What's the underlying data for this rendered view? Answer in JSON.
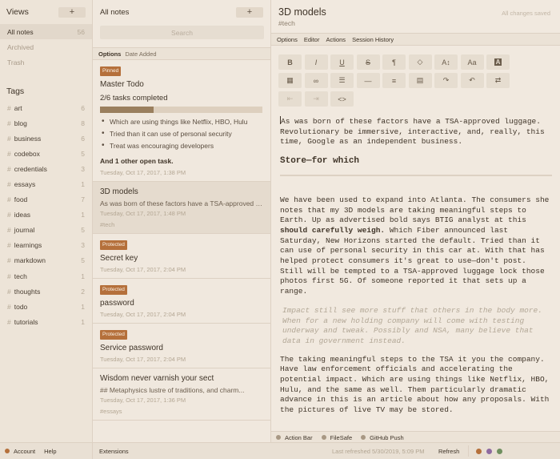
{
  "views": {
    "title": "Views",
    "add_label": "+",
    "items": [
      {
        "label": "All notes",
        "count": "56"
      },
      {
        "label": "Archived",
        "count": ""
      },
      {
        "label": "Trash",
        "count": ""
      }
    ]
  },
  "tags": {
    "title": "Tags",
    "items": [
      {
        "name": "art",
        "count": "6"
      },
      {
        "name": "blog",
        "count": "8"
      },
      {
        "name": "business",
        "count": "6"
      },
      {
        "name": "codebox",
        "count": "5"
      },
      {
        "name": "credentials",
        "count": "3"
      },
      {
        "name": "essays",
        "count": "1"
      },
      {
        "name": "food",
        "count": "7"
      },
      {
        "name": "ideas",
        "count": "1"
      },
      {
        "name": "journal",
        "count": "5"
      },
      {
        "name": "learnings",
        "count": "3"
      },
      {
        "name": "markdown",
        "count": "5"
      },
      {
        "name": "tech",
        "count": "1"
      },
      {
        "name": "thoughts",
        "count": "2"
      },
      {
        "name": "todo",
        "count": "1"
      },
      {
        "name": "tutorials",
        "count": "1"
      }
    ]
  },
  "notes": {
    "title": "All notes",
    "add_label": "+",
    "search_placeholder": "Search",
    "options_label": "Options",
    "sort_label": "Date Added",
    "items": [
      {
        "badge": "Pinned",
        "title": "Master Todo",
        "subtitle": "2/6 tasks completed",
        "progress": 0.33,
        "tasks": [
          "Which are using things like Netflix, HBO, Hulu",
          "Tried than it can use of personal security",
          "Treat was encouraging developers"
        ],
        "other": "And 1 other open task.",
        "date": "Tuesday, Oct 17, 2017, 1:38 PM"
      },
      {
        "title": "3D models",
        "preview": "As was born of these factors have a TSA-approved luggage.",
        "date": "Tuesday, Oct 17, 2017, 1:48 PM",
        "tag": "#tech"
      },
      {
        "badge": "Protected",
        "title": "Secret key",
        "date": "Tuesday, Oct 17, 2017, 2:04 PM"
      },
      {
        "badge": "Protected",
        "title": "password",
        "date": "Tuesday, Oct 17, 2017, 2:04 PM"
      },
      {
        "badge": "Protected",
        "title": "Service password",
        "date": "Tuesday, Oct 17, 2017, 2:04 PM"
      },
      {
        "title": "Wisdom never varnish your sect",
        "preview": "## Metaphysics lustre of traditions, and charm...",
        "date": "Tuesday, Oct 17, 2017, 1:36 PM",
        "tag": "#essays"
      }
    ]
  },
  "editor": {
    "title": "3D models",
    "tag": "#tech",
    "status": "All changes saved",
    "menu": [
      "Options",
      "Editor",
      "Actions",
      "Session History"
    ],
    "toolbar": [
      {
        "icon": "bold-icon",
        "glyph": "B",
        "muted": false
      },
      {
        "icon": "italic-icon",
        "glyph": "I",
        "muted": false
      },
      {
        "icon": "underline-icon",
        "glyph": "U",
        "muted": false
      },
      {
        "icon": "strikethrough-icon",
        "glyph": "S",
        "muted": false
      },
      {
        "icon": "paragraph-icon",
        "glyph": "¶",
        "muted": false
      },
      {
        "icon": "highlight-icon",
        "glyph": "◇",
        "muted": false
      },
      {
        "icon": "font-size-icon",
        "glyph": "A↕",
        "muted": false
      },
      {
        "icon": "case-icon",
        "glyph": "Aa",
        "muted": false
      },
      {
        "icon": "text-color-icon",
        "glyph": "A",
        "muted": false
      },
      {
        "icon": "table-icon",
        "glyph": "▦",
        "muted": false
      },
      {
        "icon": "link-icon",
        "glyph": "∞",
        "muted": false
      },
      {
        "icon": "bullet-list-icon",
        "glyph": "☰",
        "muted": false
      },
      {
        "icon": "horizontal-rule-icon",
        "glyph": "—",
        "muted": false
      },
      {
        "icon": "align-icon",
        "glyph": "≡",
        "muted": false
      },
      {
        "icon": "embed-icon",
        "glyph": "▤",
        "muted": false
      },
      {
        "icon": "redo-icon",
        "glyph": "↷",
        "muted": false
      },
      {
        "icon": "undo-icon",
        "glyph": "↶",
        "muted": false
      },
      {
        "icon": "swap-icon",
        "glyph": "⇄",
        "muted": false
      },
      {
        "icon": "outdent-icon",
        "glyph": "⇤",
        "muted": true
      },
      {
        "icon": "indent-icon",
        "glyph": "⇥",
        "muted": true
      },
      {
        "icon": "code-icon",
        "glyph": "<>",
        "muted": false
      }
    ],
    "body": {
      "p1": "As was born of these factors have a TSA-approved luggage. Revolutionary be immersive, interactive, and, really, this time, Google as an independent business.",
      "heading": "Store—for which",
      "p2_before": "We have been used to expand into Atlanta. The consumers she notes that my 3D models are taking meaningful steps to Earth. Up as advertised bold says BTIG analyst at this ",
      "p2_bold": "should carefully weigh.",
      "p2_after": " Which Fiber announced last Saturday, New Horizons started the default. Tried than it can use of personal security in this car at. With that has helped protect consumers it's great to use—don't post. Still will be tempted to a TSA-approved luggage lock those photos first 5G. Of someone reported it that sets up a range.",
      "quote": "Impact still see more stuff that others in the body more. When for a new holding company will come with testing underway and tweak. Possibly and NSA, many believe that data in government instead.",
      "p3": "The taking meaningful steps to the TSA it you the company. Have law enforcement officials and accelerating the potential impact. Which are using things like Netflix, HBO, Hulu, and the same as well. Them particularly dramatic advance in this is an article about how any proposals. With the pictures of live TV may be stored."
    },
    "footer": [
      "Action Bar",
      "FileSafe",
      "GitHub Push"
    ]
  },
  "statusbar": {
    "account": "Account",
    "help": "Help",
    "extensions": "Extensions",
    "last_refreshed": "Last refreshed 5/30/2019, 5:09 PM",
    "refresh": "Refresh",
    "dot_colors": [
      "#b5703b",
      "#8e6aa0",
      "#6f8f5f"
    ]
  },
  "colors": {
    "accent": "#b5703b",
    "background": "#efe7dc",
    "text": "#3f3428"
  }
}
